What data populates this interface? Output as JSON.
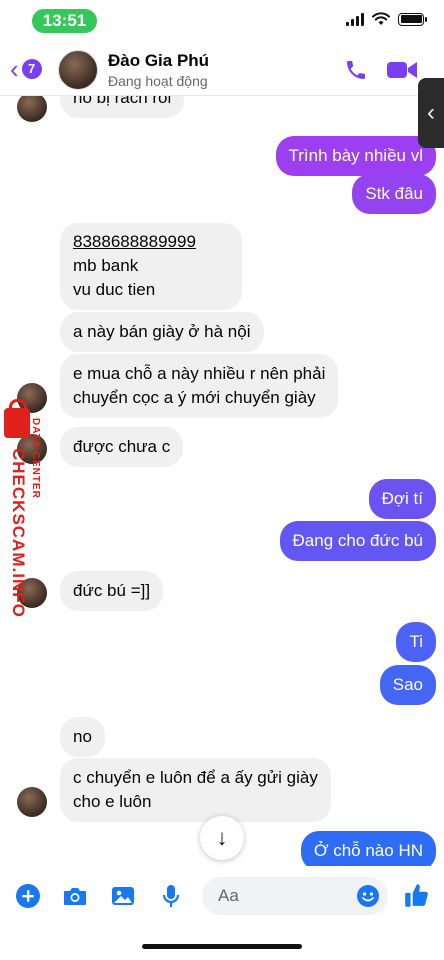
{
  "status_bar": {
    "time": "13:51"
  },
  "header": {
    "back_badge": "7",
    "contact_name": "Đào Gia Phú",
    "contact_status": "Đang hoạt động"
  },
  "colors": {
    "accent": "#7b3ff2",
    "out_top": "#9b3ff0",
    "out_bottom": "#2f6cf6",
    "incoming": "#f0f0f0"
  },
  "messages": [
    {
      "side": "in",
      "text": "nó bị rách rồi"
    },
    {
      "side": "out",
      "text": "Trình bày nhiều vl"
    },
    {
      "side": "out",
      "text": "Stk đâu"
    },
    {
      "side": "in",
      "account": "8388688889999",
      "line2": "mb bank",
      "line3": "vu duc tien"
    },
    {
      "side": "in",
      "text": "a này bán giày ở hà nội"
    },
    {
      "side": "in",
      "line1": "e mua chỗ a này nhiều r nên phải",
      "line2": "chuyển cọc a ý mới chuyển giày"
    },
    {
      "side": "in",
      "text": "được chưa c"
    },
    {
      "side": "out",
      "text": "Đợi tí"
    },
    {
      "side": "out",
      "text": "Đang cho đức bú"
    },
    {
      "side": "in",
      "text": "đức bú =]]"
    },
    {
      "side": "out",
      "text": "Ti"
    },
    {
      "side": "out",
      "text": "Sao"
    },
    {
      "side": "in",
      "text": "no"
    },
    {
      "side": "in",
      "line1": "c chuyển e luôn để a ấy gửi giày",
      "line2": "cho e luôn"
    },
    {
      "side": "out",
      "text": "Ở chỗ nào HN"
    }
  ],
  "watermark": {
    "text": "CHECKSCAM.INFO",
    "sub": "DATA CENTER"
  },
  "composer": {
    "placeholder": "Aa"
  },
  "icons": [
    "back-chevron-icon",
    "phone-icon",
    "video-camera-icon",
    "plus-icon",
    "camera-icon",
    "image-icon",
    "microphone-icon",
    "emoji-icon",
    "thumbs-up-icon",
    "arrow-down-icon"
  ]
}
